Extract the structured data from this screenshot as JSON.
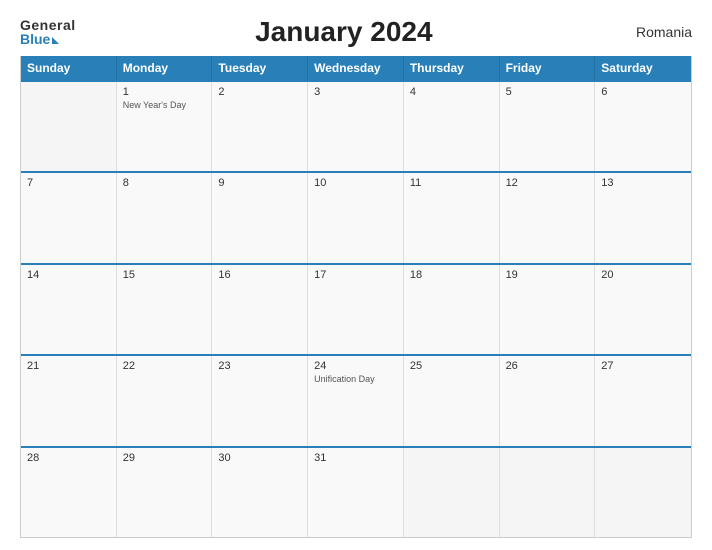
{
  "header": {
    "logo_general": "General",
    "logo_blue": "Blue",
    "title": "January 2024",
    "country": "Romania"
  },
  "calendar": {
    "days_of_week": [
      "Sunday",
      "Monday",
      "Tuesday",
      "Wednesday",
      "Thursday",
      "Friday",
      "Saturday"
    ],
    "weeks": [
      [
        {
          "day": "",
          "holiday": ""
        },
        {
          "day": "1",
          "holiday": "New Year's Day"
        },
        {
          "day": "2",
          "holiday": ""
        },
        {
          "day": "3",
          "holiday": ""
        },
        {
          "day": "4",
          "holiday": ""
        },
        {
          "day": "5",
          "holiday": ""
        },
        {
          "day": "6",
          "holiday": ""
        }
      ],
      [
        {
          "day": "7",
          "holiday": ""
        },
        {
          "day": "8",
          "holiday": ""
        },
        {
          "day": "9",
          "holiday": ""
        },
        {
          "day": "10",
          "holiday": ""
        },
        {
          "day": "11",
          "holiday": ""
        },
        {
          "day": "12",
          "holiday": ""
        },
        {
          "day": "13",
          "holiday": ""
        }
      ],
      [
        {
          "day": "14",
          "holiday": ""
        },
        {
          "day": "15",
          "holiday": ""
        },
        {
          "day": "16",
          "holiday": ""
        },
        {
          "day": "17",
          "holiday": ""
        },
        {
          "day": "18",
          "holiday": ""
        },
        {
          "day": "19",
          "holiday": ""
        },
        {
          "day": "20",
          "holiday": ""
        }
      ],
      [
        {
          "day": "21",
          "holiday": ""
        },
        {
          "day": "22",
          "holiday": ""
        },
        {
          "day": "23",
          "holiday": ""
        },
        {
          "day": "24",
          "holiday": "Unification Day"
        },
        {
          "day": "25",
          "holiday": ""
        },
        {
          "day": "26",
          "holiday": ""
        },
        {
          "day": "27",
          "holiday": ""
        }
      ],
      [
        {
          "day": "28",
          "holiday": ""
        },
        {
          "day": "29",
          "holiday": ""
        },
        {
          "day": "30",
          "holiday": ""
        },
        {
          "day": "31",
          "holiday": ""
        },
        {
          "day": "",
          "holiday": ""
        },
        {
          "day": "",
          "holiday": ""
        },
        {
          "day": "",
          "holiday": ""
        }
      ]
    ]
  }
}
